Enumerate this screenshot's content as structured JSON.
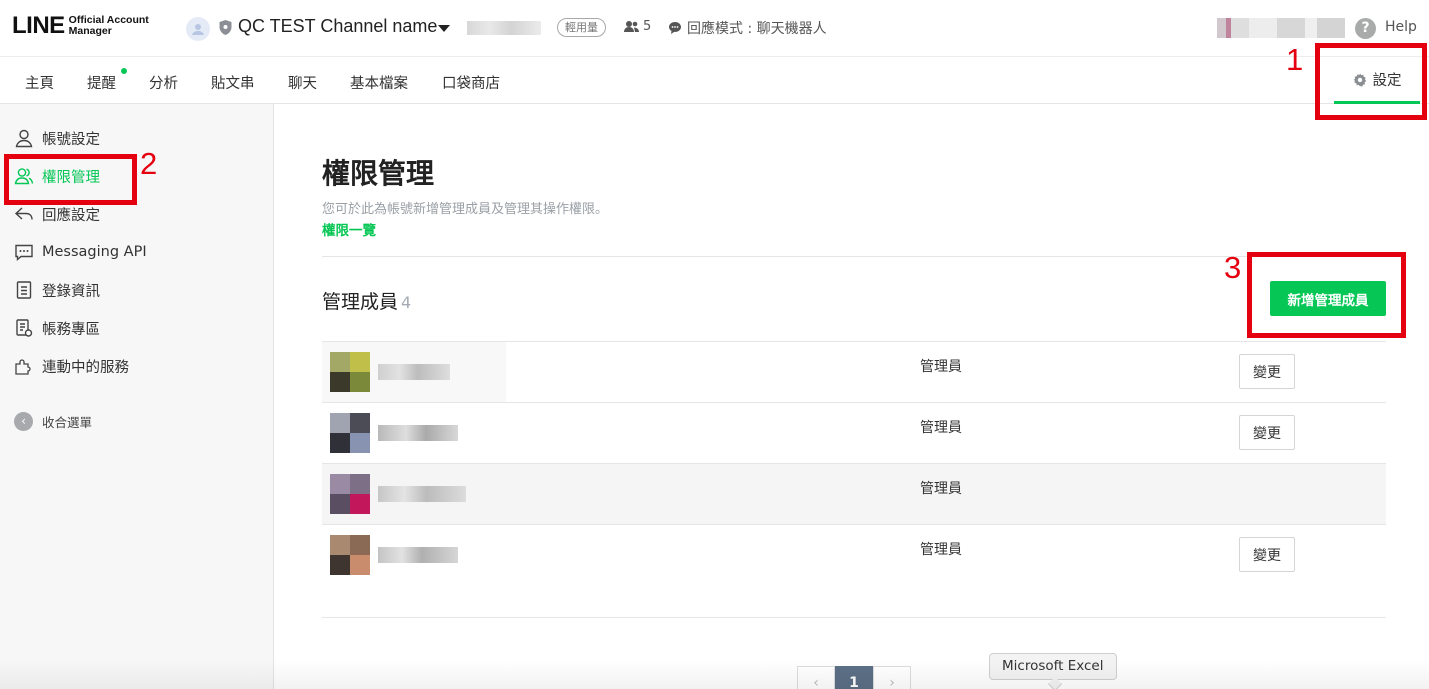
{
  "header": {
    "logo_main": "LINE",
    "logo_sub_line1": "Official Account",
    "logo_sub_line2": "Manager",
    "account_name": "QC TEST Channel name",
    "plan_badge": "輕用量",
    "friends_count": "5",
    "reply_mode": "回應模式 : 聊天機器人",
    "help": "Help"
  },
  "nav": {
    "items": [
      "主頁",
      "提醒",
      "分析",
      "貼文串",
      "聊天",
      "基本檔案",
      "口袋商店"
    ],
    "settings": "設定"
  },
  "sidebar": {
    "items": [
      "帳號設定",
      "權限管理",
      "回應設定",
      "Messaging API",
      "登錄資訊",
      "帳務專區",
      "連動中的服務"
    ],
    "active_index": 1,
    "collapse": "收合選單"
  },
  "main": {
    "title": "權限管理",
    "description": "您可於此為帳號新增管理成員及管理其操作權限。",
    "permission_link": "權限一覽",
    "members_title": "管理成員",
    "members_count": "4",
    "add_member_button": "新增管理成員",
    "members": [
      {
        "role": "管理員",
        "action": "變更"
      },
      {
        "role": "管理員",
        "action": "變更"
      },
      {
        "role": "管理員",
        "action": ""
      },
      {
        "role": "管理員",
        "action": "變更"
      }
    ],
    "pagination": {
      "current_page": "1"
    }
  },
  "tooltip": "Microsoft Excel",
  "annotations": [
    "1",
    "2",
    "3"
  ],
  "colors": {
    "accent": "#06c755",
    "annotation": "#e4000f",
    "pager_active": "#5b6f86"
  }
}
